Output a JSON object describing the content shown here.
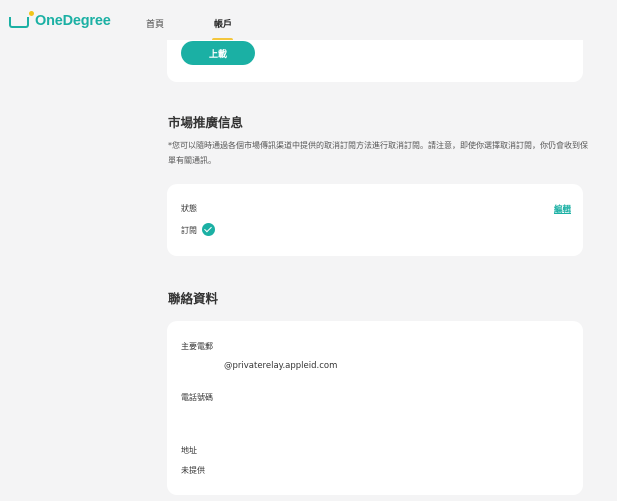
{
  "brand": {
    "name": "OneDegree"
  },
  "nav": {
    "home": "首頁",
    "account": "帳戶"
  },
  "top_card": {
    "upload_label": "上載"
  },
  "marketing": {
    "title": "市場推廣信息",
    "note": "*您可以隨時通過各個市場傳訊渠道中提供的取消訂閱方法進行取消訂閱。請注意，即使你選擇取消訂閱，你仍會收到保單有關通訊。",
    "status_label": "狀態",
    "status_value": "訂閱",
    "edit_label": "編輯"
  },
  "contact": {
    "title": "聯絡資料",
    "email_label": "主要電郵",
    "email_value": "@privaterelay.appleid.com",
    "phone_label": "電話號碼",
    "phone_value": "",
    "address_label": "地址",
    "address_value": "未提供"
  },
  "colors": {
    "accent": "#1bb0a4",
    "nav_indicator": "#f3c63d",
    "background": "#f4f4f5"
  }
}
